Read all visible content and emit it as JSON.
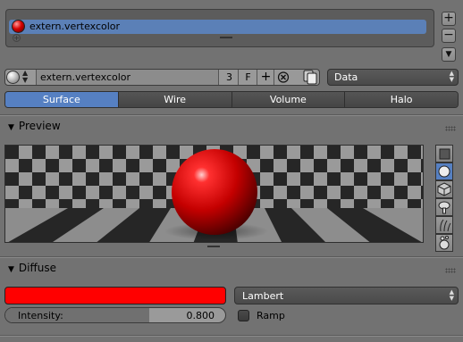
{
  "material_slots": {
    "items": [
      {
        "name": "extern.vertexcolor",
        "selected": true
      }
    ]
  },
  "datablock": {
    "name": "extern.vertexcolor",
    "users": "3",
    "fake_user": "F",
    "link_dropdown": "Data"
  },
  "type_tabs": [
    {
      "label": "Surface",
      "active": true
    },
    {
      "label": "Wire",
      "active": false
    },
    {
      "label": "Volume",
      "active": false
    },
    {
      "label": "Halo",
      "active": false
    }
  ],
  "preview_panel": {
    "title": "Preview",
    "shapes": [
      "plane-icon",
      "sphere-icon",
      "cube-icon",
      "monkey-icon",
      "hair-icon",
      "sphere-sky-icon"
    ],
    "active_shape": "sphere-icon"
  },
  "diffuse_panel": {
    "title": "Diffuse",
    "color": "#ff0000",
    "shader": "Lambert",
    "intensity_label": "Intensity:",
    "intensity_value": "0.800",
    "intensity_fraction": 0.8,
    "ramp_label": "Ramp",
    "ramp_enabled": false
  },
  "colors": {
    "background": "#727272",
    "accent": "#5680c2",
    "material": "#d60000"
  }
}
